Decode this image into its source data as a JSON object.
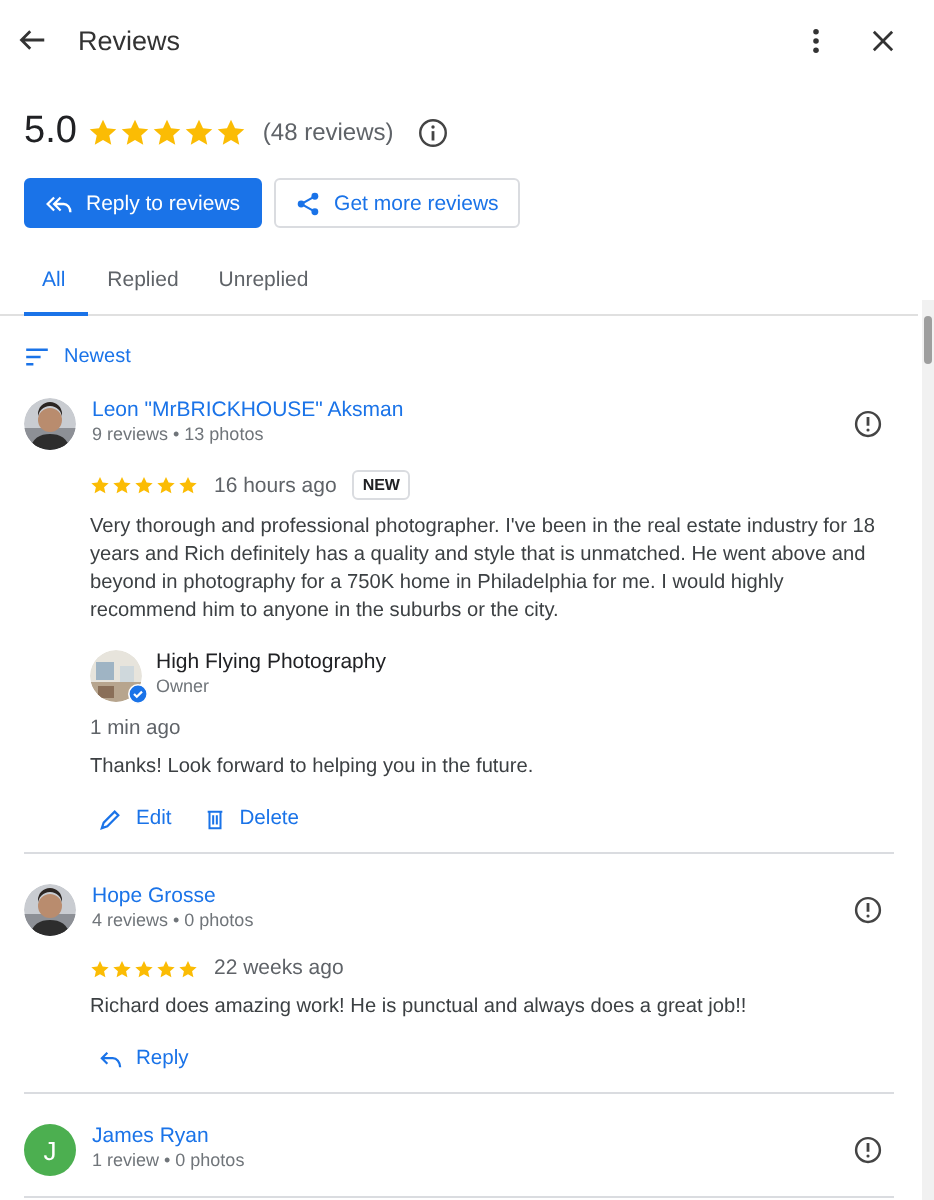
{
  "header": {
    "title": "Reviews"
  },
  "summary": {
    "score": "5.0",
    "stars": 5,
    "count": "(48 reviews)"
  },
  "buttons": [
    {
      "kind": "primary",
      "label": "Reply to reviews"
    },
    {
      "kind": "secondary",
      "label": "Get more reviews"
    }
  ],
  "tabs": [
    {
      "label": "All",
      "selected": true
    },
    {
      "label": "Replied",
      "selected": false
    },
    {
      "label": "Unreplied",
      "selected": false
    }
  ],
  "sort": {
    "label": "Newest"
  },
  "reviews": [
    {
      "name": "Leon \"MrBRICKHOUSE\" Aksman",
      "meta": "9 reviews • 13 photos",
      "avatar": {
        "kind": "picture"
      },
      "stars": 5,
      "time": "16 hours ago",
      "badge": "NEW",
      "text": "Very thorough and professional photographer. I've been in the real estate industry for 18 years and Rich definitely has a quality and style that is unmatched. He went above and beyond in photography for a 750K home in Philadelphia for me. I would highly recommend him to anyone in the suburbs or the city.",
      "owner_reply": {
        "name": "High Flying Photography",
        "role": "Owner",
        "time": "1 min ago",
        "text": "Thanks! Look forward to helping you in the future."
      },
      "actions": [
        {
          "kind": "edit",
          "label": "Edit"
        },
        {
          "kind": "delete",
          "label": "Delete"
        }
      ]
    },
    {
      "name": "Hope Grosse",
      "meta": "4 reviews • 0 photos",
      "avatar": {
        "kind": "picture"
      },
      "stars": 5,
      "time": "22 weeks ago",
      "text": "Richard does amazing work! He is punctual and always does a great job!!",
      "actions": [
        {
          "kind": "reply",
          "label": "Reply"
        }
      ]
    },
    {
      "name": "James Ryan",
      "meta": "1 review • 0 photos",
      "avatar": {
        "kind": "letter",
        "letter": "J",
        "color": "#4caf50"
      }
    }
  ]
}
